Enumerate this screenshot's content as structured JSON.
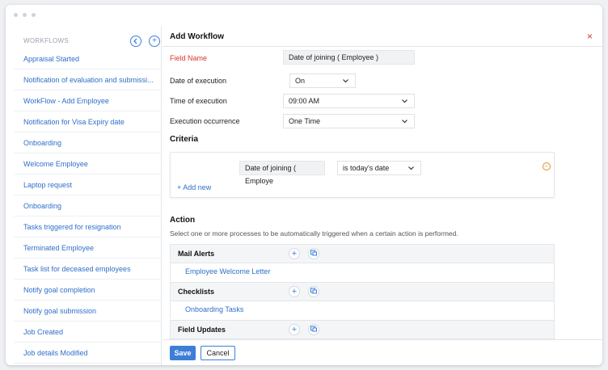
{
  "sidebar": {
    "title": "WORKFLOWS",
    "back_icon": "chevron-left",
    "add_icon": "+",
    "items": [
      "Appraisal Started",
      "Notification of evaluation and submissi...",
      "WorkFlow - Add Employee",
      "Notification for Visa Expiry date",
      "Onboarding",
      "Welcome Employee",
      "Laptop request",
      "Onboarding",
      "Tasks triggered for resignation",
      "Terminated Employee",
      "Task list for deceased employees",
      "Notify goal completion",
      "Notify goal submission",
      "Job Created",
      "Job details Modified"
    ]
  },
  "form": {
    "title": "Add Workflow",
    "close_icon": "×",
    "field_name_label": "Field Name",
    "field_name_value": "Date of joining ( Employee )",
    "date_of_execution_label": "Date of execution",
    "date_of_execution_value": "On",
    "time_of_execution_label": "Time of execution",
    "time_of_execution_value": "09:00 AM",
    "execution_occurrence_label": "Execution occurrence",
    "execution_occurrence_value": "One Time"
  },
  "criteria": {
    "title": "Criteria",
    "field": "Date of joining ( Employe",
    "condition": "is today's date",
    "add_new": "+ Add new"
  },
  "action": {
    "title": "Action",
    "description": "Select one or more processes to be automatically triggered when a certain action is performed.",
    "groups": [
      {
        "title": "Mail Alerts",
        "item": "Employee Welcome Letter"
      },
      {
        "title": "Checklists",
        "item": "Onboarding Tasks"
      },
      {
        "title": "Field Updates"
      }
    ]
  },
  "footer": {
    "save_label": "Save",
    "cancel_label": "Cancel"
  },
  "colors": {
    "accent": "#3d7ed8",
    "link": "#2f6fc9",
    "required": "#d9342b"
  }
}
